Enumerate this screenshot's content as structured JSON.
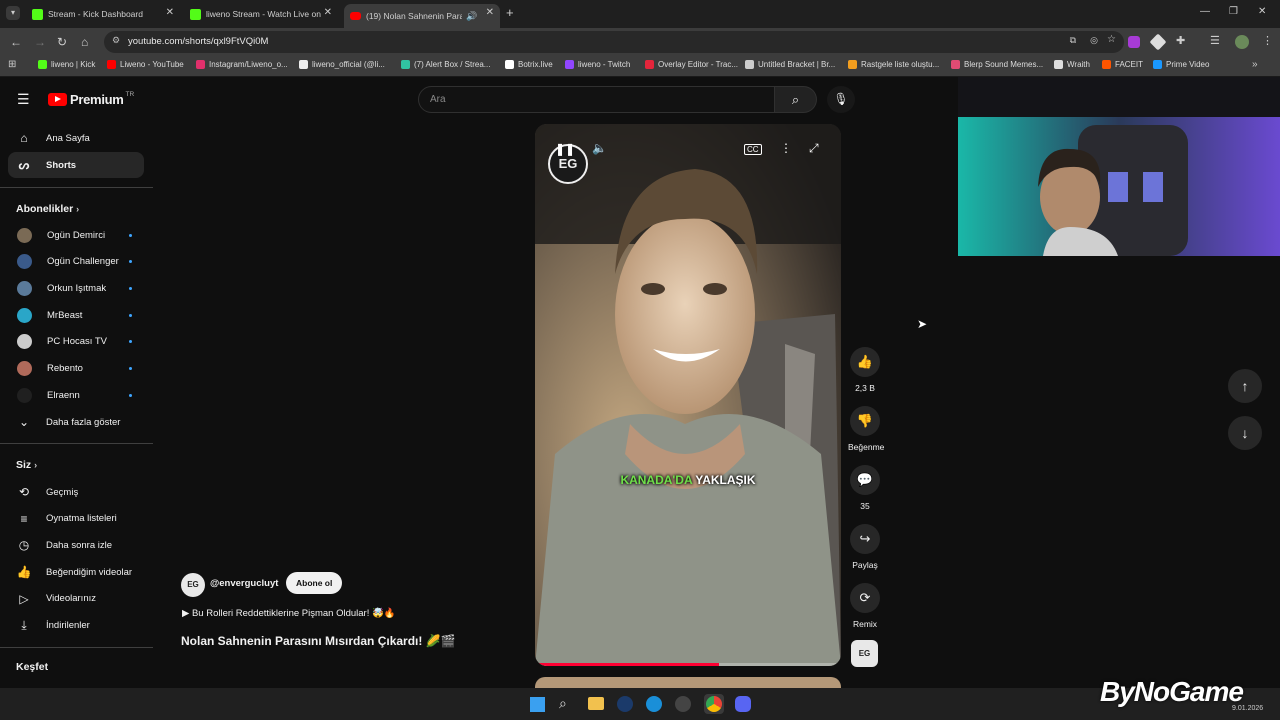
{
  "tabs": [
    {
      "title": "Stream - Kick Dashboard",
      "color": "#53fc18"
    },
    {
      "title": "liweno Stream - Watch Live on",
      "color": "#53fc18"
    },
    {
      "title": "(19) Nolan Sahnenin Parası",
      "color": "#ff0000"
    }
  ],
  "new_tab": "+",
  "address": {
    "url": "youtube.com/shorts/qxl9FtVQi0M"
  },
  "bookmarks": [
    {
      "label": "liweno | Kick",
      "color": "#53fc18"
    },
    {
      "label": "Liweno - YouTube",
      "color": "#ff0000"
    },
    {
      "label": "Instagram/Liweno_o...",
      "color": "#e1306c"
    },
    {
      "label": "liweno_official (@li...",
      "color": "#eeeeee"
    },
    {
      "label": "(7) Alert Box / Strea...",
      "color": "#31c3a2"
    },
    {
      "label": "Botrix.live",
      "color": "#ffffff"
    },
    {
      "label": "liweno - Twitch",
      "color": "#9146ff"
    },
    {
      "label": "Overlay Editor - Trac...",
      "color": "#e4253b"
    },
    {
      "label": "Untitled Bracket | Br...",
      "color": "#cccccc"
    },
    {
      "label": "Rastgele liste oluştu...",
      "color": "#f29e1f"
    },
    {
      "label": "Blerp Sound Memes...",
      "color": "#e14b73"
    },
    {
      "label": "Wraith",
      "color": "#dddddd"
    },
    {
      "label": "FACEIT",
      "color": "#ff5500"
    },
    {
      "label": "Prime Video",
      "color": "#1a98ff"
    }
  ],
  "masthead": {
    "logo": "Premium",
    "region": "TR",
    "search_placeholder": "Ara"
  },
  "sidebar": {
    "main": [
      {
        "label": "Ana Sayfa",
        "icon": "home-icon"
      },
      {
        "label": "Shorts",
        "icon": "shorts-icon"
      }
    ],
    "subs_title": "Abonelikler",
    "subs": [
      {
        "label": "Ogün Demirci",
        "color": "#7a6a55"
      },
      {
        "label": "Ogün Challenger",
        "color": "#3a5a8a"
      },
      {
        "label": "Orkun Işıtmak",
        "color": "#5a7a9a"
      },
      {
        "label": "MrBeast",
        "color": "#2aa6c8"
      },
      {
        "label": "PC Hocası TV",
        "color": "#cccccc"
      },
      {
        "label": "Rebento",
        "color": "#b06a5a"
      },
      {
        "label": "Elraenn",
        "color": "#202020"
      }
    ],
    "more": "Daha fazla göster",
    "you_title": "Siz",
    "you": [
      {
        "label": "Geçmiş",
        "icon": "history-icon"
      },
      {
        "label": "Oynatma listeleri",
        "icon": "playlist-icon"
      },
      {
        "label": "Daha sonra izle",
        "icon": "clock-icon"
      },
      {
        "label": "Beğendiğim videolar",
        "icon": "like-icon"
      },
      {
        "label": "Videolarınız",
        "icon": "video-icon"
      },
      {
        "label": "İndirilenler",
        "icon": "download-icon"
      }
    ],
    "explore_title": "Keşfet"
  },
  "short": {
    "channel": "@envergucluyt",
    "subscribe": "Abone ol",
    "playlist": "▶ Bu Rolleri Reddettiklerine Pişman Oldular! 🤯🔥",
    "title": "Nolan Sahnenin Parasını Mısırdan Çıkardı! 🌽🎬",
    "caption_a": "KANADA'DA",
    "caption_b": " YAKLAŞIK",
    "progress": 0.6,
    "logo_text": "EG"
  },
  "actions": {
    "likes": "2,3 B",
    "dislike": "Beğenme",
    "comments": "35",
    "share": "Paylaş",
    "remix": "Remix"
  },
  "watermark": "ByNoGame",
  "taskbar_time": "9.01.2026"
}
